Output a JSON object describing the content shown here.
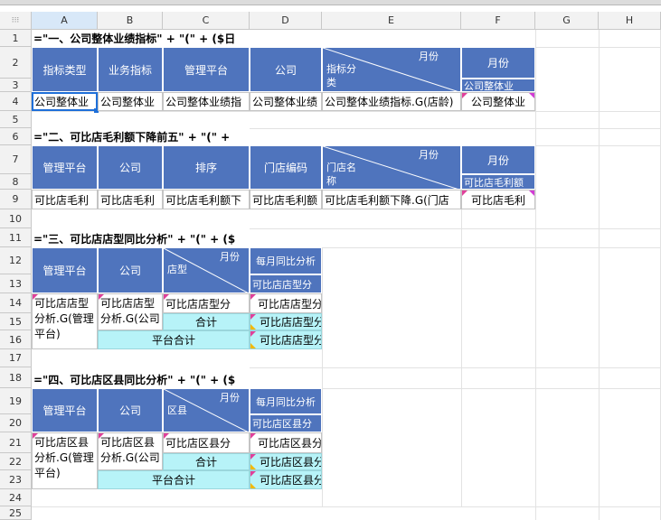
{
  "columns": [
    "A",
    "B",
    "C",
    "D",
    "E",
    "F",
    "G",
    "H"
  ],
  "rows": [
    "1",
    "2",
    "3",
    "4",
    "5",
    "6",
    "7",
    "8",
    "9",
    "10",
    "11",
    "12",
    "13",
    "14",
    "15",
    "16",
    "17",
    "18",
    "19",
    "20",
    "21",
    "22",
    "23",
    "24",
    "25"
  ],
  "s1": {
    "title": "=\"一、公司整体业绩指标\" + \"(\" + ($日",
    "h_type": "指标类型",
    "h_metric": "业务指标",
    "h_platform": "管理平台",
    "h_company": "公司",
    "e_month": "月份",
    "e_sub": "指标分类",
    "f_month": "月份",
    "f_sub": "公司整体业",
    "r4": [
      "公司整体业",
      "公司整体业",
      "公司整体业绩指",
      "公司整体业绩",
      "公司整体业绩指标.G(店龄)",
      "公司整体业"
    ]
  },
  "s2": {
    "title": "=\"二、可比店毛利额下降前五\" + \"(\" +",
    "h_platform": "管理平台",
    "h_company": "公司",
    "h_rank": "排序",
    "h_store_code": "门店编码",
    "e_month": "月份",
    "e_sub": "门店名称",
    "f_month": "月份",
    "f_sub": "可比店毛利额",
    "r9": [
      "可比店毛利",
      "可比店毛利",
      "可比店毛利额下",
      "可比店毛利额",
      "可比店毛利额下降.G(门店",
      "可比店毛利"
    ]
  },
  "s3": {
    "title": "=\"三、可比店店型同比分析\" + \"(\" + ($",
    "h_platform": "管理平台",
    "h_company": "公司",
    "c_month": "月份",
    "c_sub": "店型",
    "d_top": "每月同比分析",
    "d_sub": "可比店店型分",
    "a14": "可比店店型分析.G(管理平台)",
    "b14": "可比店店型分析.G(公司",
    "c14": "可比店店型分",
    "c15": "合计",
    "b16": "平台合计",
    "d14": "可比店店型分",
    "d15": "可比店店型分",
    "d16": "可比店店型分"
  },
  "s4": {
    "title": "=\"四、可比店区县同比分析\" + \"(\" + ($",
    "h_platform": "管理平台",
    "h_company": "公司",
    "c_month": "月份",
    "c_sub": "区县",
    "d_top": "每月同比分析",
    "d_sub": "可比店区县分",
    "a21": "可比店区县分析.G(管理平台)",
    "b21": "可比店区县分析.G(公司",
    "c21": "可比店区县分",
    "c22": "合计",
    "b23": "平台合计",
    "d21": "可比店区县分",
    "d22": "可比店区县分",
    "d23": "可比店区县分"
  }
}
